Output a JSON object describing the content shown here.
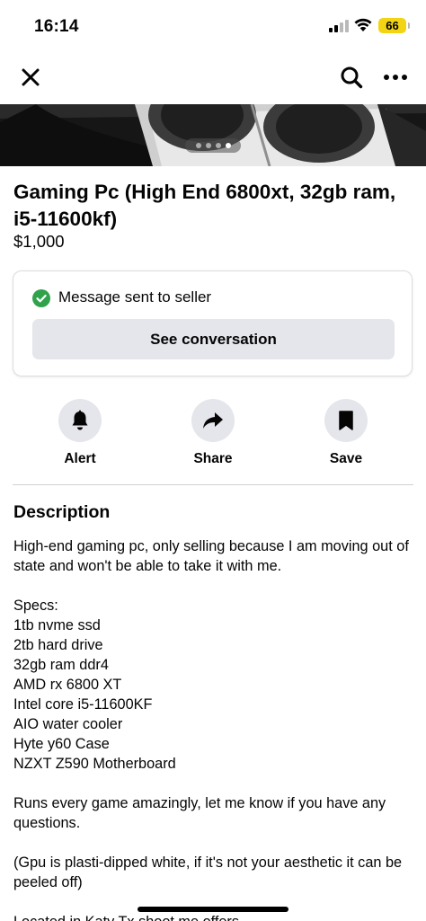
{
  "status_bar": {
    "time": "16:14",
    "battery": "66",
    "icons": [
      "cellular-signal-icon",
      "wifi-icon",
      "battery-icon"
    ]
  },
  "nav": {
    "icons": [
      "close-icon",
      "search-icon",
      "more-icon"
    ]
  },
  "photo": {
    "photo_count": 4,
    "active_index": 4
  },
  "listing": {
    "title": "Gaming Pc (High End 6800xt, 32gb ram, i5-11600kf)",
    "price": "$1,000"
  },
  "message_card": {
    "status_text": "Message sent to seller",
    "button_label": "See conversation",
    "status_color": "#31a24c"
  },
  "actions": [
    {
      "label": "Alert",
      "icon": "bell-icon"
    },
    {
      "label": "Share",
      "icon": "share-arrow-icon"
    },
    {
      "label": "Save",
      "icon": "bookmark-icon"
    }
  ],
  "description": {
    "heading": "Description",
    "intro": "High-end gaming pc, only selling because I am moving out of state and won't be able to take it with me.",
    "specs_heading": "Specs:",
    "specs": [
      "1tb nvme ssd",
      "2tb hard drive",
      "32gb ram ddr4",
      "AMD rx 6800 XT",
      "Intel core i5-11600KF",
      "AIO water cooler",
      "Hyte y60 Case",
      "NZXT Z590 Motherboard"
    ],
    "paragraph_2": "Runs every game amazingly, let me know if you have any questions.",
    "paragraph_3": "(Gpu is plasti-dipped white, if it's not your aesthetic it can be peeled off)",
    "paragraph_4": "Located in Katy Tx shoot me offers"
  }
}
